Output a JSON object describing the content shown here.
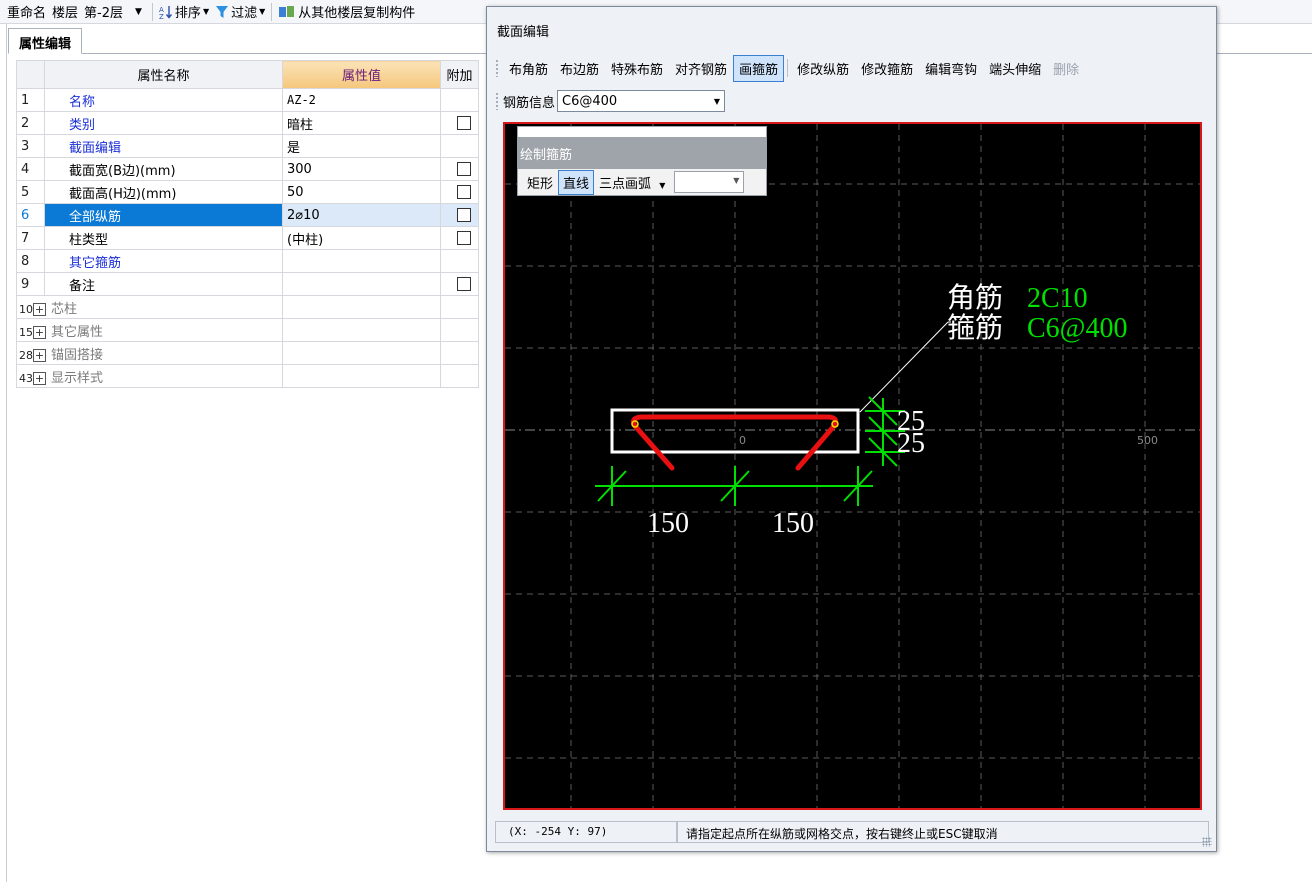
{
  "toolbar": {
    "rename": "重命名",
    "floor_label": "楼层",
    "floor_value": "第-2层",
    "sort": "排序",
    "filter": "过滤",
    "copy_from_floor": "从其他楼层复制构件"
  },
  "panel": {
    "tab": "属性编辑",
    "headers": {
      "name": "属性名称",
      "value": "属性值",
      "extra": "附加"
    },
    "rows": [
      {
        "num": "1",
        "name": "名称",
        "value": "AZ-2",
        "check": false
      },
      {
        "num": "2",
        "name": "类别",
        "value": "暗柱",
        "check": true
      },
      {
        "num": "3",
        "name": "截面编辑",
        "value": "是",
        "check": false
      },
      {
        "num": "4",
        "name": "截面宽(B边)(mm)",
        "value": "300",
        "check": true
      },
      {
        "num": "5",
        "name": "截面高(H边)(mm)",
        "value": "50",
        "check": true
      },
      {
        "num": "6",
        "name": "全部纵筋",
        "value": "2⌀10",
        "check": true
      },
      {
        "num": "7",
        "name": "柱类型",
        "value": "(中柱)",
        "check": true
      },
      {
        "num": "8",
        "name": "其它箍筋",
        "value": "",
        "check": false
      },
      {
        "num": "9",
        "name": "备注",
        "value": "",
        "check": true
      },
      {
        "num": "10",
        "name": "芯柱",
        "value": "",
        "check": false
      },
      {
        "num": "15",
        "name": "其它属性",
        "value": "",
        "check": false
      },
      {
        "num": "28",
        "name": "锚固搭接",
        "value": "",
        "check": false
      },
      {
        "num": "43",
        "name": "显示样式",
        "value": "",
        "check": false
      }
    ],
    "expander_symbol": "+"
  },
  "dialog": {
    "title": "截面编辑",
    "tools": [
      "布角筋",
      "布边筋",
      "特殊布筋",
      "对齐钢筋",
      "画箍筋",
      "修改纵筋",
      "修改箍筋",
      "编辑弯钩",
      "端头伸缩",
      "删除"
    ],
    "rebar_info_label": "钢筋信息",
    "rebar_info_value": "C6@400",
    "draw_panel": {
      "title": "绘制箍筋",
      "rect": "矩形",
      "line": "直线",
      "arc": "三点画弧"
    },
    "canvas": {
      "label_corner": "角筋",
      "label_corner_value": "2C10",
      "label_stirrup": "箍筋",
      "label_stirrup_value": "C6@400",
      "dim_25a": "25",
      "dim_25b": "25",
      "dim_150a": "150",
      "dim_150b": "150",
      "axis_zero": "0",
      "axis_500": "500",
      "colors": {
        "background": "#000000",
        "stirrup": "#e81010",
        "dimension": "#00e000",
        "outline": "#ffffff",
        "frame": "#d81818"
      }
    },
    "status_coords": "(X: -254 Y: 97)",
    "status_msg": "请指定起点所在纵筋或网格交点，按右键终止或ESC键取消"
  }
}
